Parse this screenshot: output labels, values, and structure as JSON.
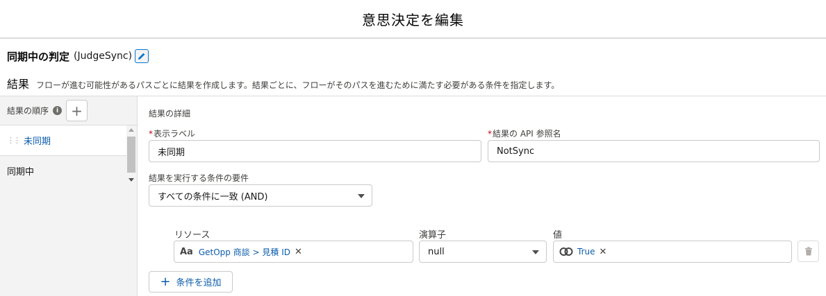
{
  "modal": {
    "title": "意思決定を編集"
  },
  "element": {
    "label": "同期中の判定",
    "api_name": "(JudgeSync)"
  },
  "outcomes": {
    "title": "結果",
    "description": "フローが進む可能性があるパスごとに結果を作成します。結果ごとに、フローがそのパスを進むために満たす必要がある条件を指定します。"
  },
  "sidebar": {
    "order_label": "結果の順序",
    "info_icon": "i",
    "add_icon": "+",
    "items": [
      {
        "label": "未同期",
        "active": true
      },
      {
        "label": "同期中",
        "active": false
      }
    ]
  },
  "detail": {
    "section_title": "結果の詳細",
    "required_mark": "*",
    "label_field": {
      "label": "表示ラベル",
      "value": "未同期"
    },
    "api_field": {
      "label": "結果の API 参照名",
      "value": "NotSync"
    },
    "condition_req": {
      "label": "結果を実行する条件の要件",
      "value": "すべての条件に一致 (AND)"
    }
  },
  "condition": {
    "resource_label": "リソース",
    "operator_label": "演算子",
    "value_label": "値",
    "resource": {
      "icon": "Aa",
      "text": "GetOpp 商談 > 見積 ID"
    },
    "operator": "null",
    "value": {
      "text": "True"
    },
    "remove_glyph": "✕"
  },
  "add_condition": {
    "label": "条件を追加",
    "icon": "+"
  },
  "colors": {
    "accent": "#0176d3",
    "link": "#0b5cab",
    "required": "#ba0517",
    "sidebar_bg": "#f3f3f3"
  }
}
